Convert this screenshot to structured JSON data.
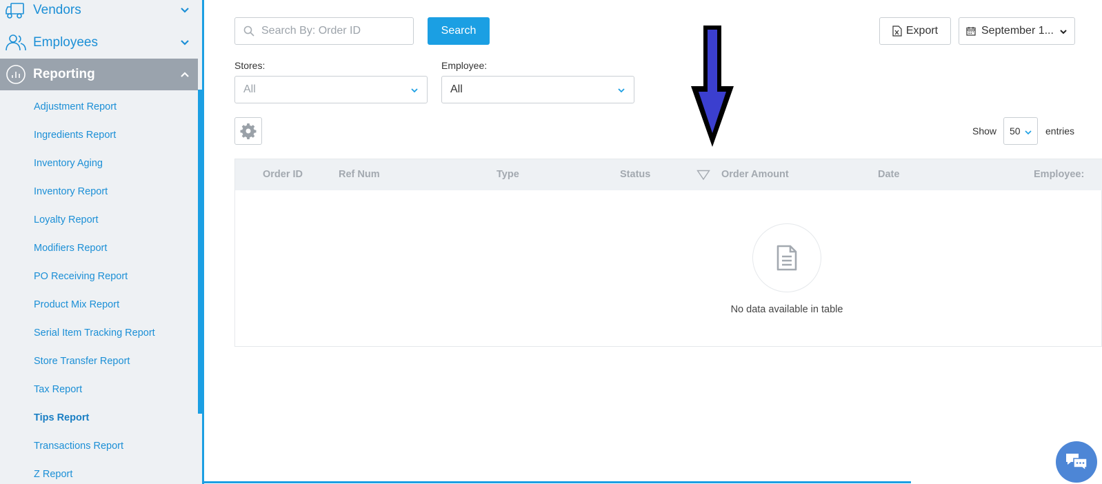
{
  "sidebar": {
    "nav": [
      {
        "label": "Vendors",
        "icon": "truck-icon"
      },
      {
        "label": "Employees",
        "icon": "users-icon"
      },
      {
        "label": "Reporting",
        "icon": "reporting-icon"
      }
    ],
    "reports": [
      "Adjustment Report",
      "Ingredients Report",
      "Inventory Aging",
      "Inventory Report",
      "Loyalty Report",
      "Modifiers Report",
      "PO Receiving Report",
      "Product Mix Report",
      "Serial Item Tracking Report",
      "Store Transfer Report",
      "Tax Report",
      "Tips Report",
      "Transactions Report",
      "Z Report"
    ],
    "current_report": "Tips Report"
  },
  "toolbar": {
    "search_placeholder": "Search By: Order ID",
    "search_label": "Search",
    "export_label": "Export",
    "date_label": "September 1..."
  },
  "filters": {
    "stores_label": "Stores:",
    "stores_value": "All",
    "employee_label": "Employee:",
    "employee_value": "All"
  },
  "entries": {
    "show_label": "Show",
    "value": "50",
    "suffix": "entries"
  },
  "table": {
    "columns": [
      "Order ID",
      "Ref Num",
      "Type",
      "Status",
      "Order Amount",
      "Date",
      "Employee:"
    ],
    "empty_message": "No data available in table"
  },
  "colors": {
    "accent": "#1b9fe3",
    "sidebar_bg": "#eef1f4",
    "active_nav": "#9aa3ad",
    "arrow_fill": "#3b3fcf",
    "chat_button": "#4d86d6"
  }
}
